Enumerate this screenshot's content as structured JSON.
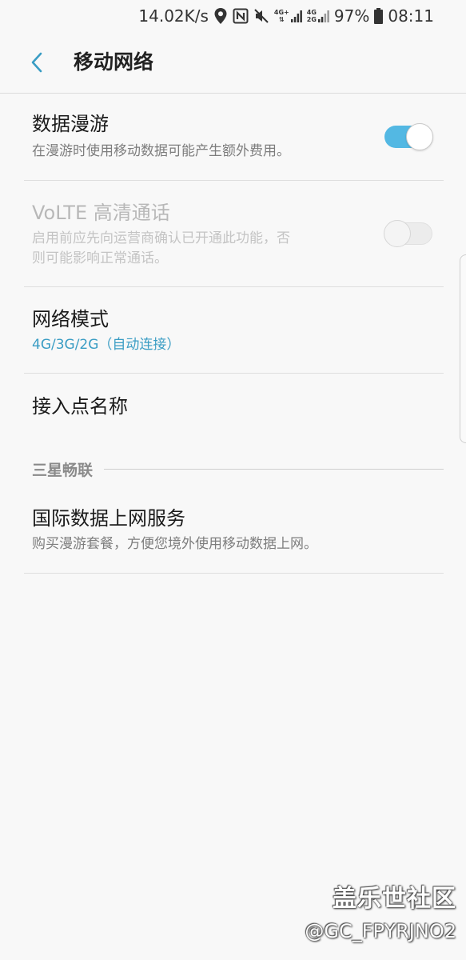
{
  "status_bar": {
    "speed": "14.02K/s",
    "icons": [
      "location-icon",
      "nfc-icon",
      "mute-icon"
    ],
    "network_1_top": "4G+",
    "network_2_top": "4G",
    "network_2_bottom": "2G",
    "battery": "97%",
    "time": "08:11"
  },
  "header": {
    "title": "移动网络"
  },
  "settings": {
    "data_roaming": {
      "title": "数据漫游",
      "subtitle": "在漫游时使用移动数据可能产生额外费用。",
      "enabled": true
    },
    "volte": {
      "title": "VoLTE 高清通话",
      "subtitle_line1": "启用前应先向运营商确认已开通此功能，否",
      "subtitle_line2": "则可能影响正常通话。",
      "enabled": false
    },
    "network_mode": {
      "title": "网络模式",
      "value": "4G/3G/2G（自动连接）"
    },
    "apn": {
      "title": "接入点名称"
    }
  },
  "section": {
    "title": "三星畅联"
  },
  "international": {
    "title": "国际数据上网服务",
    "subtitle": "购买漫游套餐，方便您境外使用移动数据上网。"
  },
  "watermark": {
    "brand": "盖乐世社区",
    "user": "@GC_FPYRJNO2"
  },
  "colors": {
    "accent": "#53b8e3",
    "accent_text": "#3a9dc4",
    "background": "#f8f8f8"
  }
}
